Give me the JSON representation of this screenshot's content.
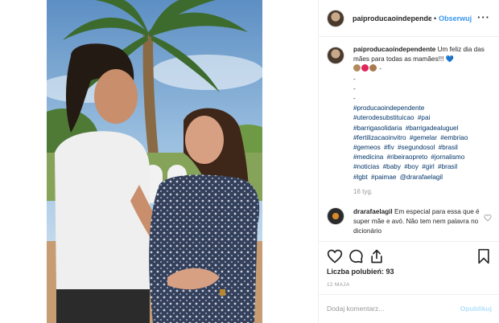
{
  "header": {
    "username": "paiproducaoindependente",
    "separator": "•",
    "follow_label": "Obserwuj",
    "more_label": "···"
  },
  "caption": {
    "username": "paiproducaoindependente",
    "text": "Um feliz dia das mães para todas as mamães!!!",
    "heart": "💙",
    "emoji_suffix": "-",
    "dashes": [
      "-",
      "-",
      "-"
    ],
    "hashtags": [
      "#producaoindependente",
      "#uterodesubstituicao",
      "#pai",
      "#barrigasolidaria",
      "#barrigadealuguel",
      "#fertilizacaoinvitro",
      "#gemelar",
      "#embriao",
      "#gemeos",
      "#fiv",
      "#segundosol",
      "#brasil",
      "#medicina",
      "#ribeiraopreto",
      "#jornalismo",
      "#noticias",
      "#baby",
      "#boy",
      "#girl",
      "#brasil",
      "#lgbt",
      "#paimae",
      "@drarafaelagil"
    ],
    "time": "16 tyg."
  },
  "comment": {
    "username": "drarafaelagil",
    "text": "Em especial para essa que é super mãe e avó. Não tem nem palavra no dicionário"
  },
  "actions": {
    "likes_label": "Liczba polubień: 93",
    "date": "12 MAJA",
    "comment_placeholder": "Dodaj komentarz...",
    "post_label": "Opublikuj"
  },
  "icons": [
    "heart-icon",
    "comment-icon",
    "share-icon",
    "bookmark-icon",
    "more-icon",
    "like-icon"
  ],
  "colors": {
    "link_blue": "#3897f0",
    "hashtag": "#003569",
    "muted": "#999999",
    "border": "#efefef"
  }
}
